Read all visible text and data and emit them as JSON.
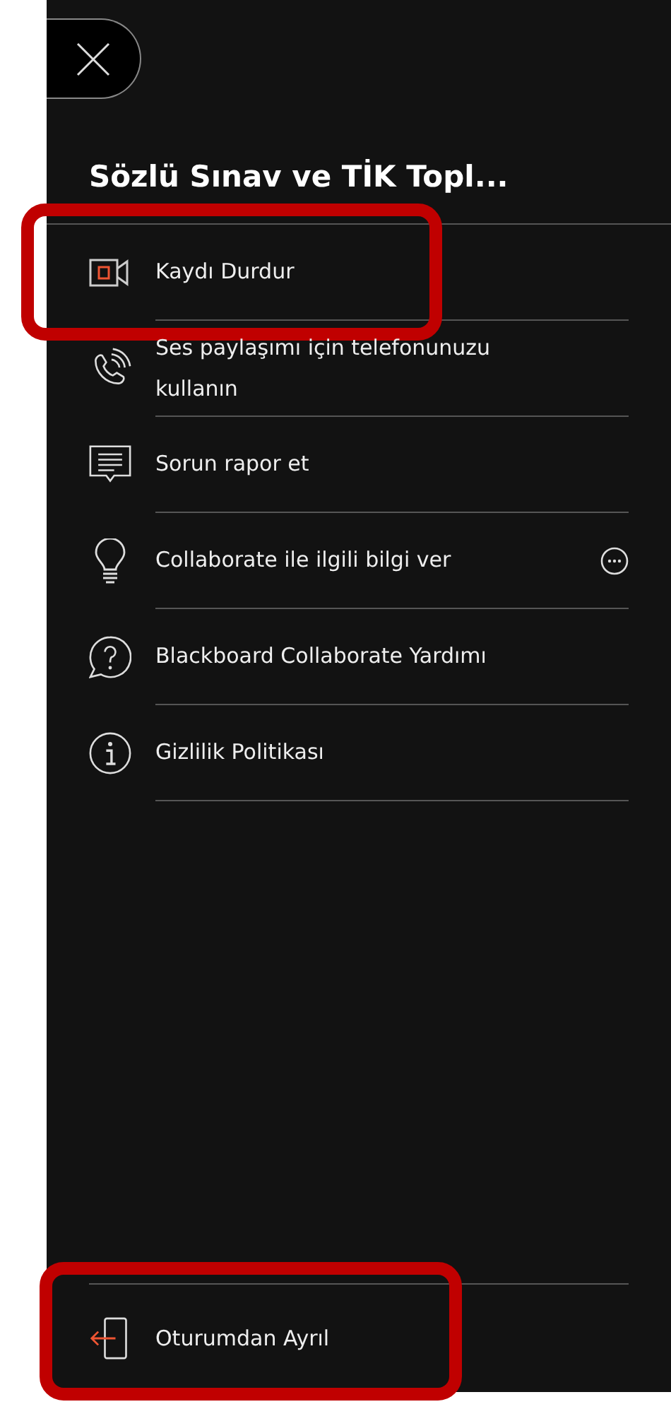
{
  "panel": {
    "title": "Sözlü Sınav ve TİK Topl...",
    "items": [
      {
        "kind": "record",
        "label": "Kaydı Durdur",
        "highlighted": true
      },
      {
        "kind": "phone",
        "label": "Ses paylaşımı için telefonunuzu kullanın",
        "highlighted": false
      },
      {
        "kind": "report",
        "label": "Sorun rapor et",
        "highlighted": false
      },
      {
        "kind": "feedback",
        "label": "Collaborate ile ilgili bilgi ver",
        "highlighted": false
      },
      {
        "kind": "help",
        "label": "Blackboard Collaborate Yardımı",
        "highlighted": false
      },
      {
        "kind": "privacy",
        "label": "Gizlilik Politikası",
        "highlighted": false
      }
    ],
    "leave": {
      "label": "Oturumdan Ayrıl",
      "highlighted": true
    }
  }
}
